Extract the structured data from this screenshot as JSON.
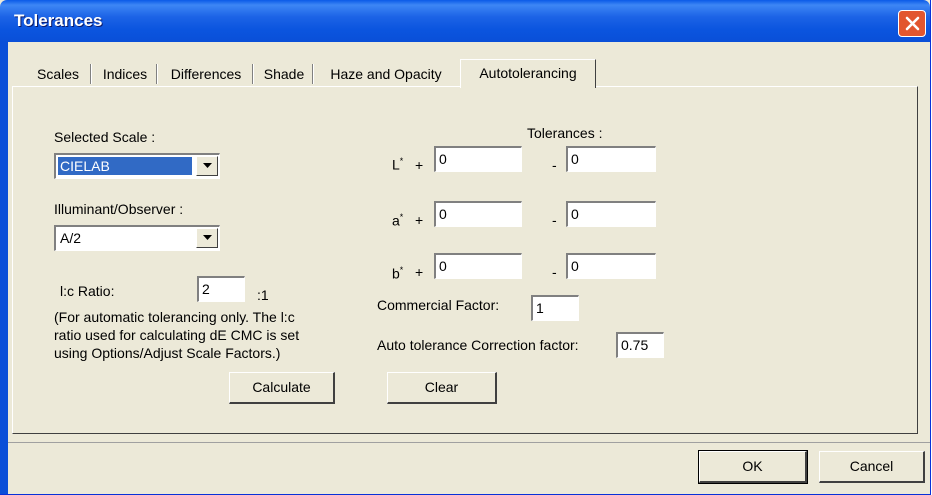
{
  "window": {
    "title": "Tolerances"
  },
  "tabs": [
    {
      "label": "Scales"
    },
    {
      "label": "Indices"
    },
    {
      "label": "Differences"
    },
    {
      "label": "Shade"
    },
    {
      "label": "Haze and Opacity"
    },
    {
      "label": "Autotolerancing"
    }
  ],
  "active_tab": "Autotolerancing",
  "left": {
    "selected_scale_label": "Selected Scale :",
    "selected_scale_value": "CIELAB",
    "illuminant_label": "Illuminant/Observer :",
    "illuminant_value": "A/2",
    "lc_ratio_label": "l:c Ratio:",
    "lc_ratio_value": "2",
    "lc_ratio_suffix": ":1",
    "note_lines": [
      "(For automatic tolerancing only.  The l:c",
      "ratio used for calculating dE CMC is set",
      "using Options/Adjust Scale Factors.)"
    ],
    "calculate_label": "Calculate"
  },
  "right": {
    "tolerances_header": "Tolerances :",
    "rows": [
      {
        "name": "L*",
        "letter": "L",
        "sup": "*",
        "plus": "+",
        "minus": "-",
        "plus_value": "0",
        "minus_value": "0"
      },
      {
        "name": "a*",
        "letter": "a",
        "sup": "*",
        "plus": "+",
        "minus": "-",
        "plus_value": "0",
        "minus_value": "0"
      },
      {
        "name": "b*",
        "letter": "b",
        "sup": "*",
        "plus": "+",
        "minus": "-",
        "plus_value": "0",
        "minus_value": "0"
      }
    ],
    "commercial_factor_label": "Commercial Factor:",
    "commercial_factor_value": "1",
    "auto_tol_label": "Auto tolerance Correction factor:",
    "auto_tol_value": "0.75",
    "clear_label": "Clear"
  },
  "footer": {
    "ok_label": "OK",
    "cancel_label": "Cancel"
  },
  "colors": {
    "titlebar": "#0a5ae8",
    "dialog_bg": "#ece9d8",
    "selection": "#316ac5",
    "close_button": "#e2562f"
  }
}
